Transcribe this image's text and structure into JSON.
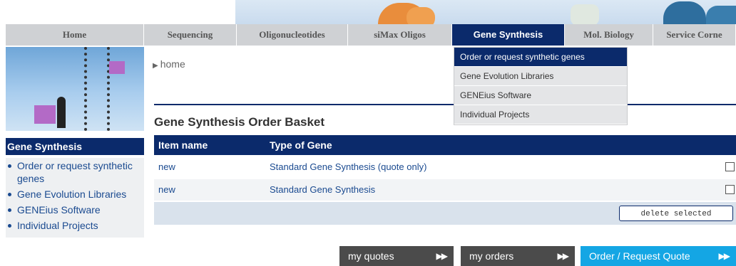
{
  "nav": {
    "items": [
      {
        "label": "Home",
        "active": false
      },
      {
        "label": "Sequencing",
        "active": false
      },
      {
        "label": "Oligonucleotides",
        "active": false
      },
      {
        "label": "siMax Oligos",
        "active": false
      },
      {
        "label": "Gene Synthesis",
        "active": true
      },
      {
        "label": "Mol. Biology",
        "active": false
      },
      {
        "label": "Service Corne",
        "active": false
      }
    ]
  },
  "dropdown": {
    "items": [
      "Order or request synthetic genes",
      "Gene Evolution Libraries",
      "GENEius Software",
      "Individual Projects"
    ]
  },
  "breadcrumb": {
    "text": "home"
  },
  "sidebar": {
    "heading": "Gene Synthesis",
    "items": [
      "Order or request synthetic genes",
      "Gene Evolution Libraries",
      "GENEius Software",
      "Individual Projects"
    ]
  },
  "basket": {
    "title": "Gene Synthesis Order Basket",
    "columns": [
      "Item name",
      "Type of Gene"
    ],
    "rows": [
      {
        "item": "new",
        "type": "Standard Gene Synthesis (quote only)"
      },
      {
        "item": "new",
        "type": "Standard Gene Synthesis"
      }
    ],
    "delete_label": "delete selected"
  },
  "buttons": {
    "quotes": "my quotes",
    "orders": "my orders",
    "request": "Order / Request Quote"
  },
  "colors": {
    "navy": "#0b2a6b",
    "nav_bg": "#cfd1d4",
    "link": "#1a4a90",
    "cta": "#14a6e4",
    "dark_button": "#4b4b4b"
  }
}
